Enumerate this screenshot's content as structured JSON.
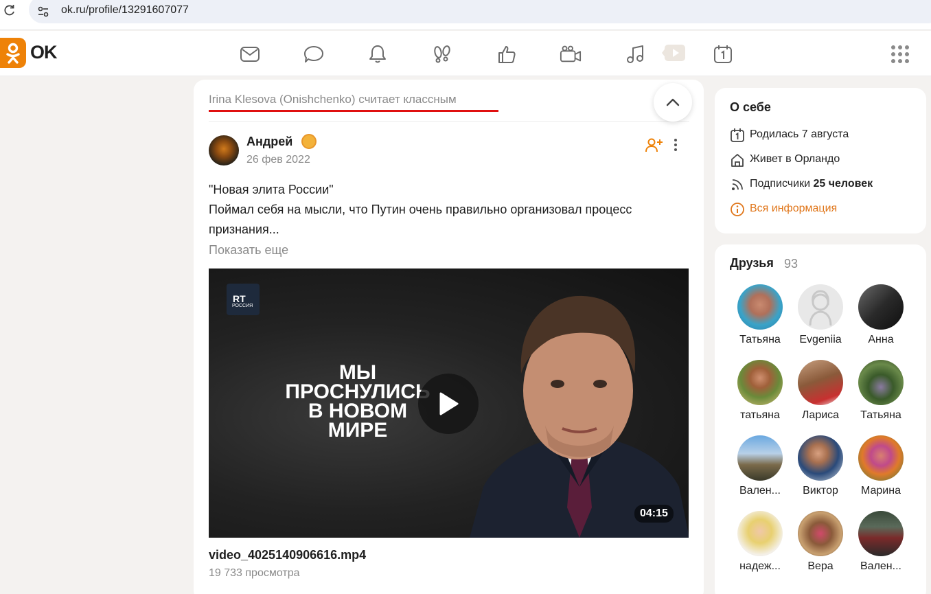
{
  "browser": {
    "url": "ok.ru/profile/13291607077"
  },
  "header": {
    "logo_text": "OK",
    "nav_icons": [
      "messages-icon",
      "discussions-icon",
      "notifications-icon",
      "guests-icon",
      "likes-icon",
      "video-icon",
      "music-icon",
      "video-promo-icon",
      "calendar-icon"
    ],
    "apps_icon": "apps-grid-icon",
    "accent_color": "#ee8208"
  },
  "feed": {
    "liked_by": "Irina Klesova (Onishchenko) считает классным",
    "post": {
      "author": "Андрей",
      "date": "26 фев 2022",
      "text_line1": "\"Новая элита России\"",
      "text_line2": "Поймал себя на мысли, что Путин очень правильно организовал процесс признания...",
      "show_more": "Показать еще",
      "video": {
        "channel_badge_line1": "RT",
        "channel_badge_line2": "РОССИЯ",
        "overlay_title": "МЫ\nПРОСНУЛИСЬ\nВ НОВОМ\nМИРЕ",
        "duration": "04:15",
        "filename": "video_4025140906616.mp4",
        "views": "19 733 просмотра"
      }
    }
  },
  "about": {
    "title": "О себе",
    "born": "Родилась 7 августа",
    "lives": "Живет в Орландо",
    "subscribers_label": "Подписчики",
    "subscribers_value": "25 человек",
    "all_info": "Вся информация"
  },
  "friends": {
    "title": "Друзья",
    "count": "93",
    "items": [
      {
        "name": "Татьяна"
      },
      {
        "name": "Evgeniia"
      },
      {
        "name": "Анна"
      },
      {
        "name": "татьяна"
      },
      {
        "name": "Лариса"
      },
      {
        "name": "Татьяна"
      },
      {
        "name": "Вален..."
      },
      {
        "name": "Виктор"
      },
      {
        "name": "Марина"
      },
      {
        "name": "надеж..."
      },
      {
        "name": "Вера"
      },
      {
        "name": "Вален..."
      }
    ]
  }
}
